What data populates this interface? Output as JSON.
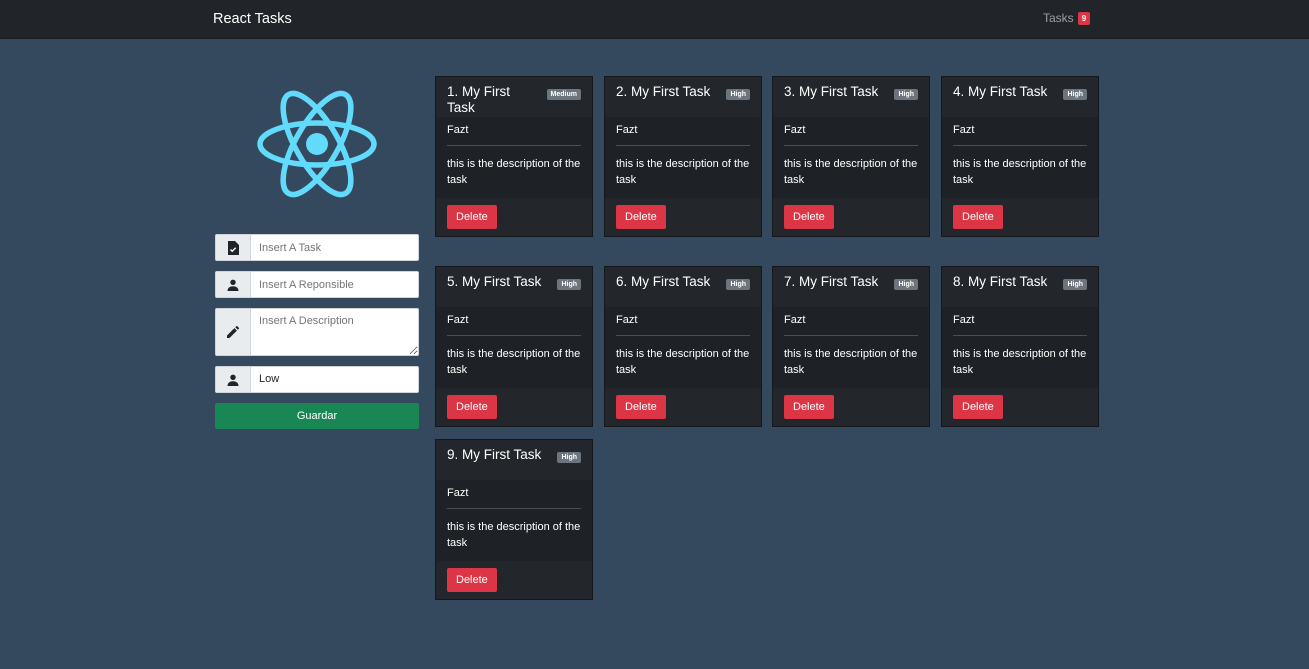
{
  "navbar": {
    "brand": "React Tasks",
    "tasks_label": "Tasks",
    "tasks_count": "9"
  },
  "form": {
    "task_placeholder": "Insert A Task",
    "responsible_placeholder": "Insert A Reponsible",
    "description_placeholder": "Insert A Description",
    "priority_selected": "Low",
    "save_label": "Guardar"
  },
  "tasks": [
    {
      "title": "1. My First Task",
      "priority": "Medium",
      "responsible": "Fazt",
      "description": "this is the description of the task",
      "delete_label": "Delete"
    },
    {
      "title": "2. My First Task",
      "priority": "High",
      "responsible": "Fazt",
      "description": "this is the description of the task",
      "delete_label": "Delete"
    },
    {
      "title": "3. My First Task",
      "priority": "High",
      "responsible": "Fazt",
      "description": "this is the description of the task",
      "delete_label": "Delete"
    },
    {
      "title": "4. My First Task",
      "priority": "High",
      "responsible": "Fazt",
      "description": "this is the description of the task",
      "delete_label": "Delete"
    },
    {
      "title": "5. My First Task",
      "priority": "High",
      "responsible": "Fazt",
      "description": "this is the description of the task",
      "delete_label": "Delete"
    },
    {
      "title": "6. My First Task",
      "priority": "High",
      "responsible": "Fazt",
      "description": "this is the description of the task",
      "delete_label": "Delete"
    },
    {
      "title": "7. My First Task",
      "priority": "High",
      "responsible": "Fazt",
      "description": "this is the description of the task",
      "delete_label": "Delete"
    },
    {
      "title": "8. My First Task",
      "priority": "High",
      "responsible": "Fazt",
      "description": "this is the description of the task",
      "delete_label": "Delete"
    },
    {
      "title": "9. My First Task",
      "priority": "High",
      "responsible": "Fazt",
      "description": "this is the description of the task",
      "delete_label": "Delete"
    }
  ],
  "icons": {
    "task_field": "task-file-icon",
    "responsible_field": "person-icon",
    "description_field": "pencil-icon",
    "priority_field": "person-icon",
    "logo": "react-logo"
  },
  "colors": {
    "background": "#34495e",
    "navbar": "#212529",
    "react_logo": "#61dafb",
    "save_button": "#198754",
    "delete_button": "#dc3545",
    "badge_secondary": "#6c757d",
    "badge_danger": "#dc3545"
  }
}
